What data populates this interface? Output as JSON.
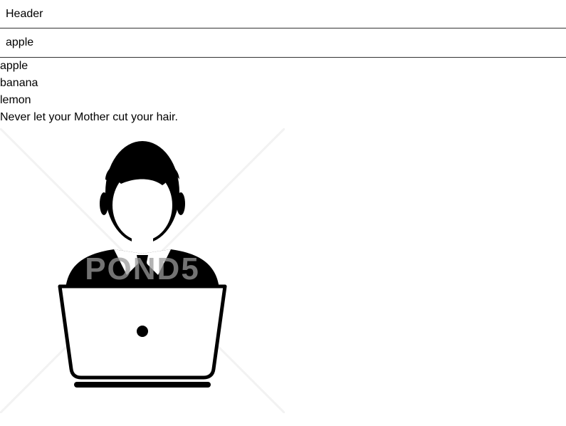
{
  "header": {
    "title": "Header"
  },
  "search": {
    "value": "apple"
  },
  "list": {
    "items": [
      "apple",
      "banana",
      "lemon"
    ]
  },
  "quote": {
    "text": "Never let your Mother cut your hair."
  },
  "image": {
    "icon": "person-with-laptop-icon",
    "watermark": "POND5"
  }
}
